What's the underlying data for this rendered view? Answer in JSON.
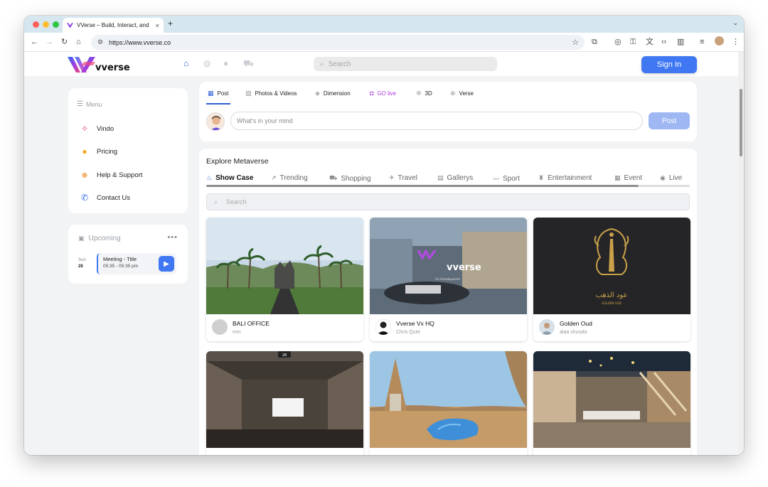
{
  "browser": {
    "tab_title": "VVerse – Build, Interact, and",
    "tab_close": "×",
    "new_tab": "+",
    "url": "https://www.vverse.co"
  },
  "header": {
    "logo_text": "vverse",
    "search_placeholder": "Search",
    "signin_label": "Sign In"
  },
  "menu": {
    "title": "Menu",
    "items": [
      {
        "label": "Vindo",
        "icon": "vindo-icon"
      },
      {
        "label": "Pricing",
        "icon": "pricing-icon"
      },
      {
        "label": "Help & Support",
        "icon": "support-icon"
      },
      {
        "label": "Contact Us",
        "icon": "phone-icon"
      }
    ]
  },
  "upcoming": {
    "title": "Upcoming",
    "more": "•••",
    "day": "Sun",
    "date": "28",
    "meeting_title": "Meeting - Title",
    "meeting_time": "05:35 - 05:35 pm"
  },
  "post_box": {
    "tabs": [
      "Post",
      "Photos & Videos",
      "Dimension",
      "GO live",
      "3D",
      "Verse"
    ],
    "placeholder": "What's in your mind",
    "post_label": "Post"
  },
  "explore": {
    "title": "Explore Metaverse",
    "categories": [
      "Show Case",
      "Trending",
      "Shopping",
      "Travel",
      "Gallerys",
      "Sport",
      "Entertainment",
      "Event",
      "Live"
    ],
    "search_placeholder": "Search",
    "worlds": [
      {
        "name": "BALI OFFICE",
        "author": "mm"
      },
      {
        "name": "Vverse Vx HQ",
        "author": "Chris Quet"
      },
      {
        "name": "Golden Oud",
        "author": "alaa shurafa"
      },
      {
        "name": "",
        "author": ""
      },
      {
        "name": "",
        "author": ""
      },
      {
        "name": "",
        "author": ""
      }
    ]
  },
  "thumb_labels": {
    "hq_logo": "vverse",
    "hq_sub": "Vx Headquarter",
    "oud_ar": "عود الذهب",
    "oud_en": "GOLDEN OUD",
    "gallery_badge": "28"
  },
  "colors": {
    "accent": "#3f78f2",
    "live": "#a93bd6",
    "page_bg": "#f2f3f5"
  }
}
